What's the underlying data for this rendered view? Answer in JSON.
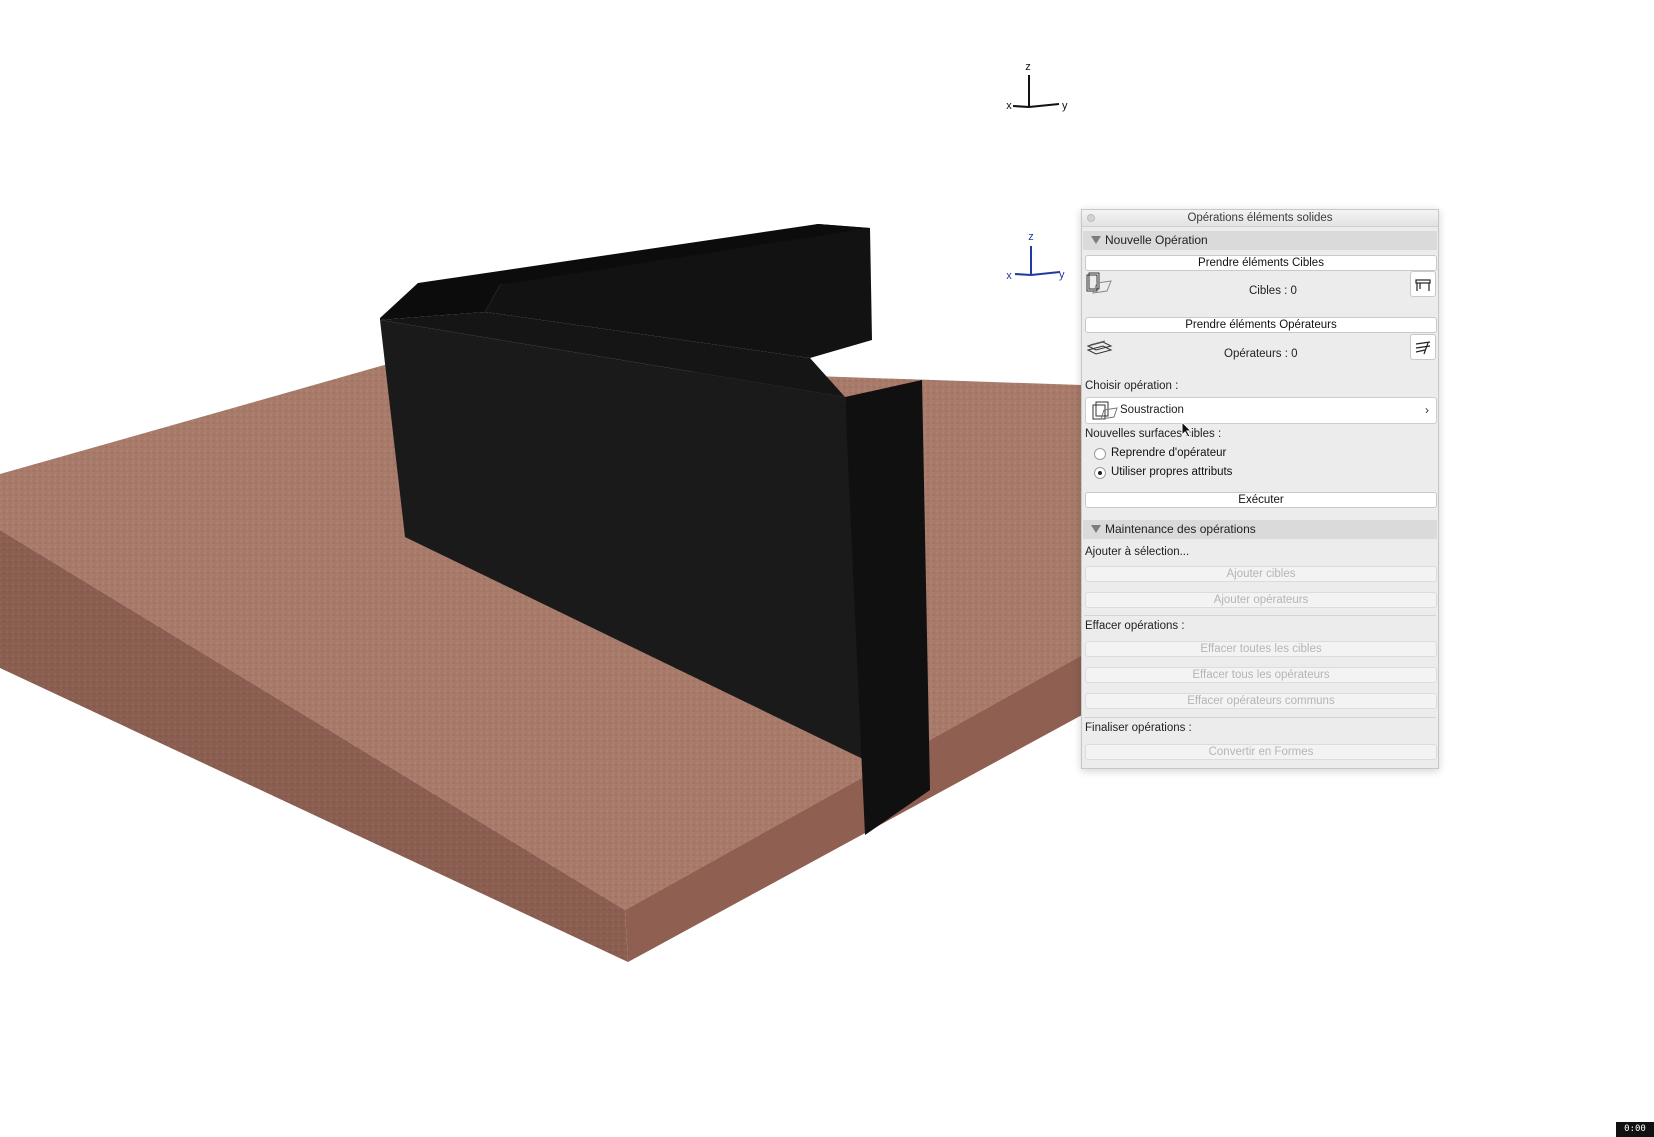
{
  "axes_top": {
    "z": "z",
    "x": "x",
    "y": "y"
  },
  "axes_mid": {
    "z": "z",
    "x": "x",
    "y": "y"
  },
  "palette": {
    "title": "Opérations éléments solides",
    "section_new": "Nouvelle Opération",
    "take_targets": "Prendre éléments Cibles",
    "targets_count": "Cibles : 0",
    "take_operators": "Prendre éléments Opérateurs",
    "operators_count": "Opérateurs : 0",
    "choose_operation": "Choisir opération :",
    "operation_value": "Soustraction",
    "new_surfaces": "Nouvelles surfaces cibles :",
    "radio_operator": "Reprendre d'opérateur",
    "radio_own": "Utiliser propres attributs",
    "execute": "Exécuter",
    "section_maint": "Maintenance des opérations",
    "add_to_selection": "Ajouter à sélection...",
    "add_targets": "Ajouter cibles",
    "add_operators": "Ajouter opérateurs",
    "erase_ops": "Effacer opérations :",
    "erase_all_targets": "Effacer toutes les cibles",
    "erase_all_operators": "Effacer tous les opérateurs",
    "erase_common_operators": "Effacer opérateurs communs",
    "finalize_ops": "Finaliser opérations :",
    "convert_shapes": "Convertir en Formes"
  },
  "badge": "0:00",
  "colors": {
    "slab": "#9a6b5c",
    "wall": "#141414",
    "axis_blue": "#1f3c9e"
  }
}
